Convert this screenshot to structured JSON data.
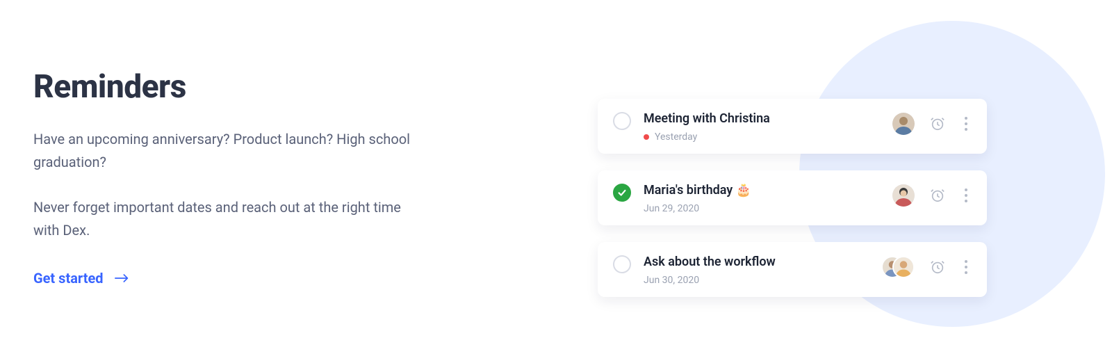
{
  "left": {
    "heading": "Reminders",
    "para1": "Have an upcoming anniversary? Product launch? High school graduation?",
    "para2": "Never forget important dates and reach out at the right time with Dex.",
    "cta": "Get started"
  },
  "reminders": [
    {
      "title": "Meeting with Christina",
      "sub": "Yesterday",
      "overdue": true,
      "done": false,
      "avatars": 1,
      "icons": {
        "snooze": "snooze-icon",
        "more": "more-icon"
      }
    },
    {
      "title": "Maria's birthday 🎂",
      "sub": "Jun  29, 2020",
      "overdue": false,
      "done": true,
      "avatars": 1,
      "icons": {
        "snooze": "snooze-icon",
        "more": "more-icon"
      }
    },
    {
      "title": "Ask about the workflow",
      "sub": "Jun 30, 2020",
      "overdue": false,
      "done": false,
      "avatars": 2,
      "icons": {
        "snooze": "snooze-icon",
        "more": "more-icon"
      }
    }
  ]
}
